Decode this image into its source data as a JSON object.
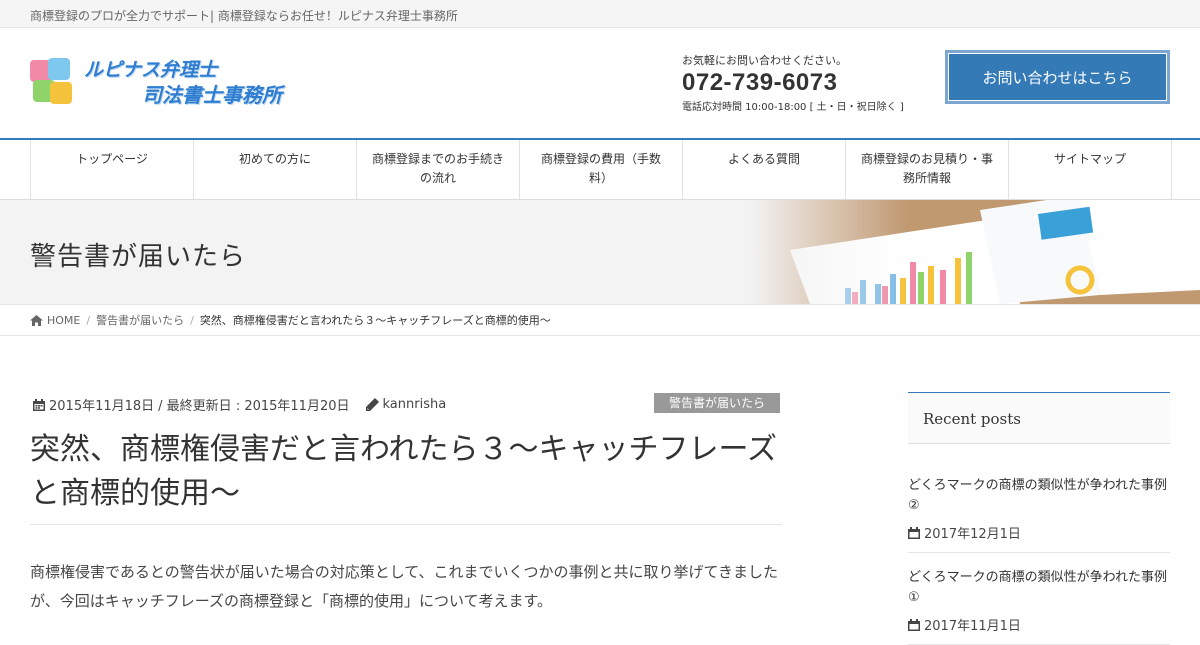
{
  "topbar": {
    "tagline": "商標登録のプロが全力でサポート| 商標登録ならお任せ！ルピナス弁理士事務所"
  },
  "header": {
    "logo_line1": "ルピナス弁理士",
    "logo_line2": "司法書士事務所",
    "contact_message": "お気軽にお問い合わせください。",
    "phone": "072-739-6073",
    "hours": "電話応対時間 10:00-18:00 [ 土・日・祝日除く ]",
    "cta_label": "お問い合わせはこちら"
  },
  "nav": {
    "items": [
      {
        "label": "トップページ"
      },
      {
        "label": "初めての方に"
      },
      {
        "label": "商標登録までのお手続きの流れ"
      },
      {
        "label": "商標登録の費用（手数料）"
      },
      {
        "label": "よくある質問"
      },
      {
        "label": "商標登録のお見積り・事務所情報"
      },
      {
        "label": "サイトマップ"
      }
    ]
  },
  "hero": {
    "title": "警告書が届いたら"
  },
  "breadcrumb": {
    "home": "HOME",
    "category": "警告書が届いたら",
    "current": "突然、商標権侵害だと言われたら３～キャッチフレーズと商標的使用～"
  },
  "post": {
    "date": "2015年11月18日",
    "updated": "/ 最終更新日 : 2015年11月20日",
    "author": "kannrisha",
    "category_badge": "警告書が届いたら",
    "title": "突然、商標権侵害だと言われたら３～キャッチフレーズと商標的使用～",
    "body": "商標権侵害であるとの警告状が届いた場合の対応策として、これまでいくつかの事例と共に取り挙げてきましたが、今回はキャッチフレーズの商標登録と「商標的使用」について考えます。"
  },
  "sidebar": {
    "heading": "Recent posts",
    "posts": [
      {
        "title": "どくろマークの商標の類似性が争われた事例②",
        "date": "2017年12月1日"
      },
      {
        "title": "どくろマークの商標の類似性が争われた事例①",
        "date": "2017年11月1日"
      }
    ]
  },
  "colors": {
    "accent": "#337ab7",
    "badge": "#999999"
  }
}
